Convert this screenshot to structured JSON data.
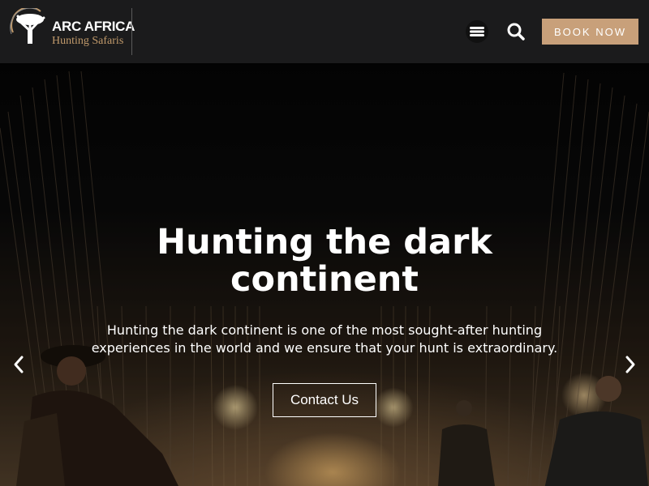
{
  "header": {
    "logo": {
      "name": "ARC AFRICA",
      "tagline": "Hunting Safaris",
      "icon": "tree-logo-icon"
    },
    "menu_icon": "hamburger-menu-icon",
    "search_icon": "search-icon",
    "book_label": "BOOK NOW"
  },
  "hero": {
    "title": "Hunting the dark continent",
    "text": "Hunting the dark continent is one of the most sought-after hunting experiences in the world and we ensure that your hunt is extraordinary.",
    "cta_label": "Contact Us",
    "prev_icon": "chevron-left-icon",
    "next_icon": "chevron-right-icon"
  },
  "colors": {
    "header_bg": "#1b1b1c",
    "accent": "#c8a07a",
    "text": "#ffffff"
  }
}
